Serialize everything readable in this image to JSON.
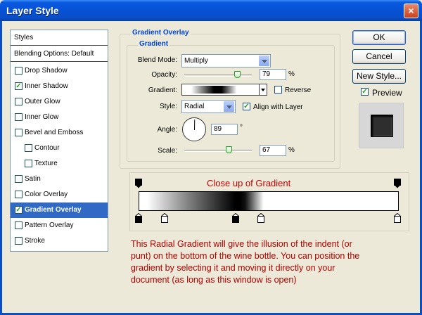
{
  "window": {
    "title": "Layer Style",
    "close_glyph": "×"
  },
  "sidebar": {
    "header": "Styles",
    "blending": "Blending Options: Default",
    "items": [
      {
        "label": "Drop Shadow",
        "checked": false,
        "sub": false,
        "selected": false
      },
      {
        "label": "Inner Shadow",
        "checked": true,
        "sub": false,
        "selected": false
      },
      {
        "label": "Outer Glow",
        "checked": false,
        "sub": false,
        "selected": false
      },
      {
        "label": "Inner Glow",
        "checked": false,
        "sub": false,
        "selected": false
      },
      {
        "label": "Bevel and Emboss",
        "checked": false,
        "sub": false,
        "selected": false
      },
      {
        "label": "Contour",
        "checked": false,
        "sub": true,
        "selected": false
      },
      {
        "label": "Texture",
        "checked": false,
        "sub": true,
        "selected": false
      },
      {
        "label": "Satin",
        "checked": false,
        "sub": false,
        "selected": false
      },
      {
        "label": "Color Overlay",
        "checked": false,
        "sub": false,
        "selected": false
      },
      {
        "label": "Gradient Overlay",
        "checked": true,
        "sub": false,
        "selected": true
      },
      {
        "label": "Pattern Overlay",
        "checked": false,
        "sub": false,
        "selected": false
      },
      {
        "label": "Stroke",
        "checked": false,
        "sub": false,
        "selected": false
      }
    ]
  },
  "panel": {
    "outer_title": "Gradient Overlay",
    "inner_title": "Gradient",
    "blend_mode_label": "Blend Mode:",
    "blend_mode_value": "Multiply",
    "opacity_label": "Opacity:",
    "opacity_value": "79",
    "opacity_unit": "%",
    "opacity_level": 0.79,
    "gradient_label": "Gradient:",
    "reverse_label": "Reverse",
    "reverse_checked": false,
    "style_label": "Style:",
    "style_value": "Radial",
    "align_label": "Align with Layer",
    "align_checked": true,
    "angle_label": "Angle:",
    "angle_value": "89",
    "angle_unit": "°",
    "scale_label": "Scale:",
    "scale_value": "67",
    "scale_unit": "%",
    "scale_level": 0.67
  },
  "closeup": {
    "title": "Close up of Gradient"
  },
  "note": "This Radial Gradient will give the illusion of the indent (or punt) on the bottom of the wine bottle. You can position the gradient by selecting it and moving it directly on your document (as long as this window is open)",
  "buttons": {
    "ok": "OK",
    "cancel": "Cancel",
    "new_style": "New Style...",
    "preview_label": "Preview",
    "preview_checked": true
  },
  "colors": {
    "accent": "#316ac5",
    "group_label": "#0046d5",
    "annotation": "#c00000",
    "check": "#21a121"
  }
}
